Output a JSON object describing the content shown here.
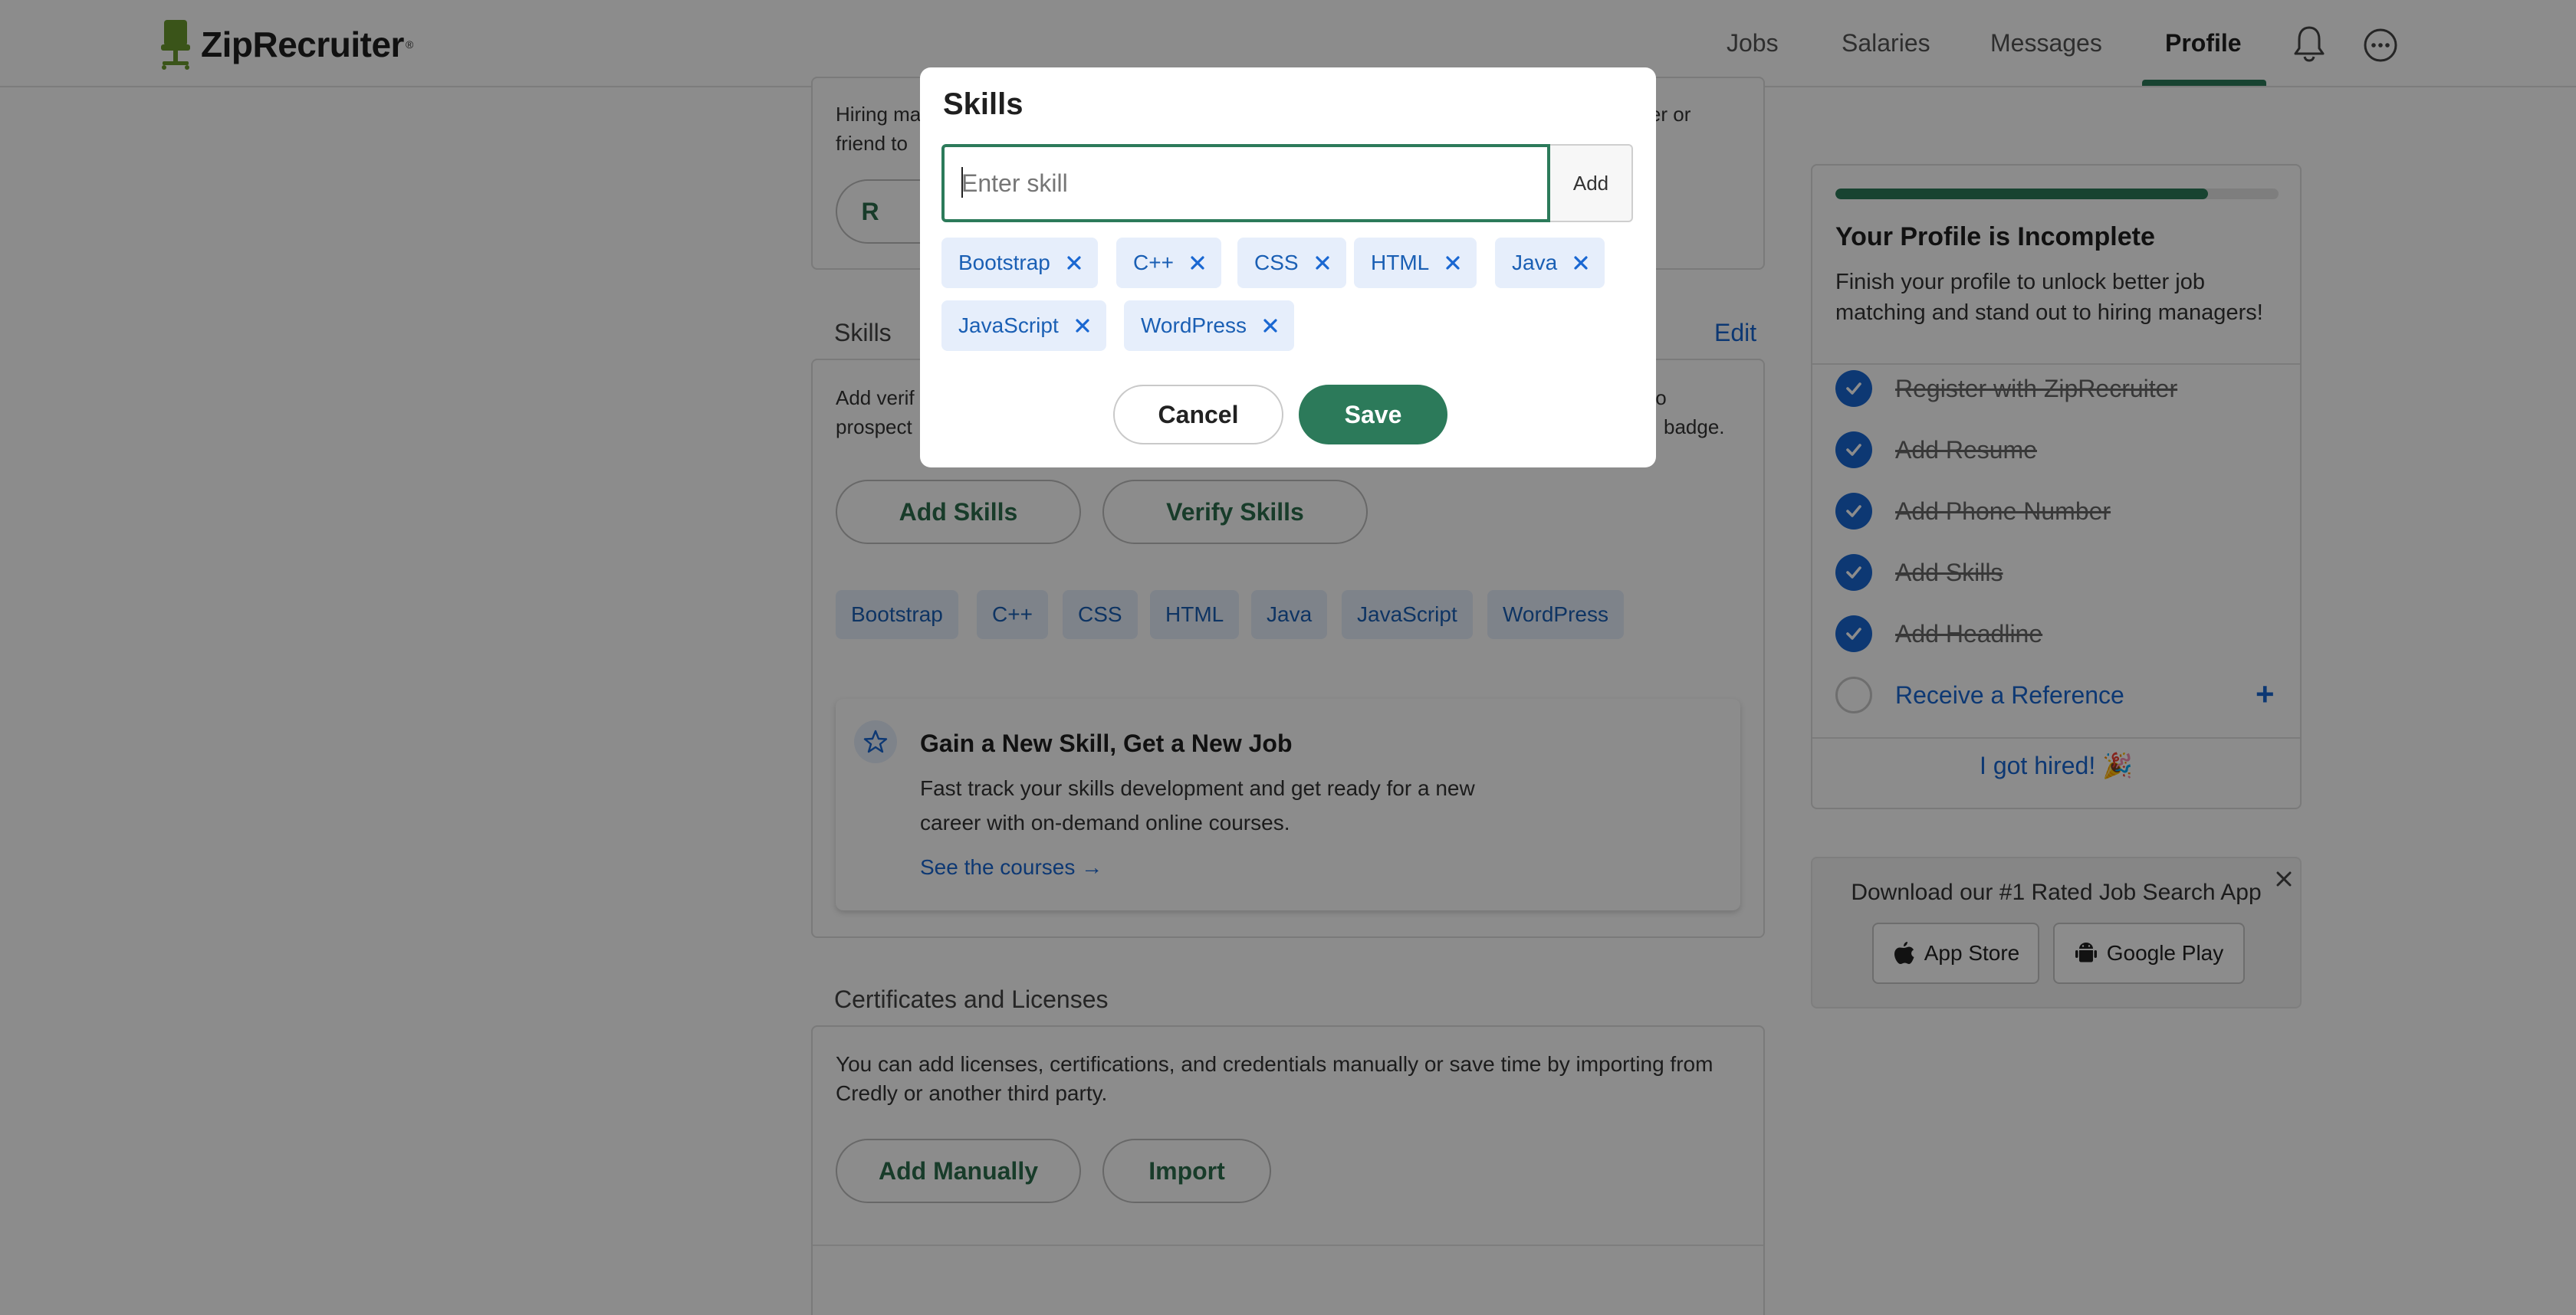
{
  "header": {
    "logo_text": "ZipRecruiter",
    "logo_reg": "®",
    "nav": [
      {
        "label": "Jobs"
      },
      {
        "label": "Salaries"
      },
      {
        "label": "Messages"
      },
      {
        "label": "Profile",
        "active": true
      }
    ]
  },
  "references": {
    "text_visible": "Hiring ma",
    "text_visible_2": "friend to",
    "text_right": "acher or",
    "button_partial": "R"
  },
  "skills_section": {
    "title": "Skills",
    "edit_label": "Edit",
    "desc_left_1": "Add verif",
    "desc_left_2": "prospect",
    "desc_right_1": "to",
    "desc_right_2": "badge.",
    "add_button": "Add Skills",
    "verify_button": "Verify Skills",
    "chips": [
      "Bootstrap",
      "C++",
      "CSS",
      "HTML",
      "Java",
      "JavaScript",
      "WordPress"
    ],
    "promo": {
      "title": "Gain a New Skill, Get a New Job",
      "body": "Fast track your skills development and get ready for a new career with on-demand online courses.",
      "link": "See the courses →"
    }
  },
  "certificates": {
    "title": "Certificates and Licenses",
    "desc": "You can add licenses, certifications, and credentials manually or save time by importing from Credly or another third party.",
    "add_button": "Add Manually",
    "import_button": "Import"
  },
  "profile_progress": {
    "progress": 0.84,
    "title": "Your Profile is Incomplete",
    "subtitle": "Finish your profile to unlock better job matching and stand out to hiring managers!",
    "steps": [
      {
        "label": "Register with ZipRecruiter",
        "done": true
      },
      {
        "label": "Add Resume",
        "done": true
      },
      {
        "label": "Add Phone Number",
        "done": true
      },
      {
        "label": "Add Skills",
        "done": true
      },
      {
        "label": "Add Headline",
        "done": true
      },
      {
        "label": "Receive a Reference",
        "done": false
      }
    ],
    "hired_label": "I got hired! 🎉"
  },
  "app_promo": {
    "text": "Download our #1 Rated Job Search App",
    "app_store": "App Store",
    "google_play": "Google Play"
  },
  "modal": {
    "title": "Skills",
    "input_placeholder": "Enter skill",
    "input_value": "",
    "add_label": "Add",
    "tags": [
      "Bootstrap",
      "C++",
      "CSS",
      "HTML",
      "Java",
      "JavaScript",
      "WordPress"
    ],
    "cancel_label": "Cancel",
    "save_label": "Save"
  },
  "colors": {
    "brand_green": "#2c7a5a",
    "link_blue": "#1967d2",
    "chip_bg": "#e6eefb",
    "overlay": "rgba(0,0,0,0.45)"
  }
}
